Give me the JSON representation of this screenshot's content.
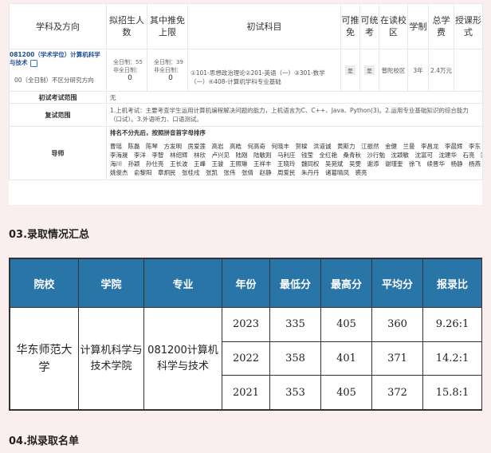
{
  "major_table": {
    "headers": [
      "学科及方向",
      "拟招生人数",
      "其中推免上限",
      "初试科目",
      "可推免",
      "可统考",
      "在读校区",
      "学制",
      "总学费",
      "授课形式"
    ],
    "program_title": "081200（学术学位）计算机科学与技术",
    "enroll_total": "全日制：55",
    "enroll_total_part": "非全日制：",
    "enroll_total_part_val": "0",
    "tuimian_total": "全日制：39",
    "tuimian_total_part": "非全日制：",
    "tuimian_total_part_val": "0",
    "direction": "00（全日制）不区分研究方向",
    "direction_enroll": "0",
    "direction_tuimian": "0",
    "subjects": "①101-思想政治理论②201-英语（一）③301-数学（一）④408-计算机学科专业基础",
    "can_tuimian": "是",
    "can_tongkao": "是",
    "campus": "普陀校区",
    "duration": "3年",
    "tuition": "2.4万元",
    "exam_scope_label": "初试考试范围",
    "exam_scope_value": "无",
    "retest_label": "复试范围",
    "retest_value": "1.上机考试：主要考查学生运用计算机编程解决问题的能力，上机语言为C、C++、Java、Python(3)。2.运用专业基础知识的综合能力（口试）。3.外语听力、口语测试。",
    "advisor_label": "导师",
    "advisor_note": "排名不分先后，按照拼音首字母排序",
    "advisor_lines": [
      "曹瑶　陈磊　陈琴　方发明　房爱莲　高岩　高皓　何高奇　何晓丰　贺樑　洪道诚　黄斯力　江振然　金健　兰曼　李昌龙　李晨辉　李东",
      "李海晟　李洋　李智　林绍辉　林欣　卢兴见　陆刚　陆敏则　马利庄　钱莹　全红艳　桑青秋　沙行勉　沈颖敏　沈富可　沈建华　石亮　宋",
      "海川　孙颖　孙仕亮　王长波　王峰　王骏　王照琳　王祥丰　王晓玲　魏同权　吴苑斌　吴雯　谢添　谢瑾奎　徐飞　续晋华　杨静　杨燕",
      "姚俊杰　俞黎阳　章炯民　张桂戌　张凯　张伟　张倩　赵静　周爱民　朱丹丹　诸葛晴凤　裘亮"
    ]
  },
  "section3_title": "03.录取情况汇总",
  "admission_table": {
    "headers": [
      "院校",
      "学院",
      "专业",
      "年份",
      "最低分",
      "最高分",
      "平均分",
      "报录比"
    ],
    "school": "华东师范大学",
    "college": "计算机科学与技术学院",
    "major": "081200计算机科学与技术",
    "rows": [
      {
        "year": "2023",
        "min": "335",
        "max": "405",
        "avg": "360",
        "ratio": "9.26:1"
      },
      {
        "year": "2022",
        "min": "358",
        "max": "401",
        "avg": "371",
        "ratio": "14.2:1"
      },
      {
        "year": "2021",
        "min": "353",
        "max": "405",
        "avg": "372",
        "ratio": "15.8:1"
      }
    ]
  },
  "section4_title": "04.拟录取名单"
}
